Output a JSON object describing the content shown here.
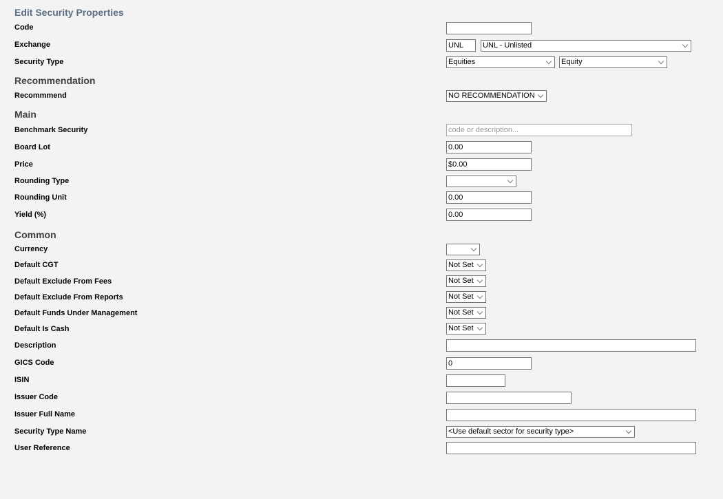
{
  "page": {
    "title": "Edit Security Properties"
  },
  "sections": {
    "recommendation": "Recommendation",
    "main": "Main",
    "common": "Common"
  },
  "fields": {
    "code": {
      "label": "Code",
      "value": ""
    },
    "exchange": {
      "label": "Exchange",
      "code_value": "UNL",
      "selected": "UNL - Unlisted"
    },
    "security_type": {
      "label": "Security Type",
      "category_selected": "Equities",
      "type_selected": "Equity"
    },
    "recommend": {
      "label": "Recommmend",
      "selected": "NO RECOMMENDATION"
    },
    "benchmark_security": {
      "label": "Benchmark Security",
      "value": "",
      "placeholder": "code or description..."
    },
    "board_lot": {
      "label": "Board Lot",
      "value": "0.00"
    },
    "price": {
      "label": "Price",
      "value": "$0.00"
    },
    "rounding_type": {
      "label": "Rounding Type",
      "selected": ""
    },
    "rounding_unit": {
      "label": "Rounding Unit",
      "value": "0.00"
    },
    "yield": {
      "label": "Yield (%)",
      "value": "0.00"
    },
    "currency": {
      "label": "Currency",
      "selected": ""
    },
    "default_cgt": {
      "label": "Default CGT",
      "selected": "Not Set"
    },
    "default_exclude_fees": {
      "label": "Default Exclude From Fees",
      "selected": "Not Set"
    },
    "default_exclude_reports": {
      "label": "Default Exclude From Reports",
      "selected": "Not Set"
    },
    "default_fum": {
      "label": "Default Funds Under Management",
      "selected": "Not Set"
    },
    "default_is_cash": {
      "label": "Default Is Cash",
      "selected": "Not Set"
    },
    "description": {
      "label": "Description",
      "value": ""
    },
    "gics_code": {
      "label": "GICS Code",
      "value": "0"
    },
    "isin": {
      "label": "ISIN",
      "value": ""
    },
    "issuer_code": {
      "label": "Issuer Code",
      "value": ""
    },
    "issuer_full_name": {
      "label": "Issuer Full Name",
      "value": ""
    },
    "security_type_name": {
      "label": "Security Type Name",
      "selected": "<Use default sector for security type>"
    },
    "user_reference": {
      "label": "User Reference",
      "value": ""
    }
  }
}
